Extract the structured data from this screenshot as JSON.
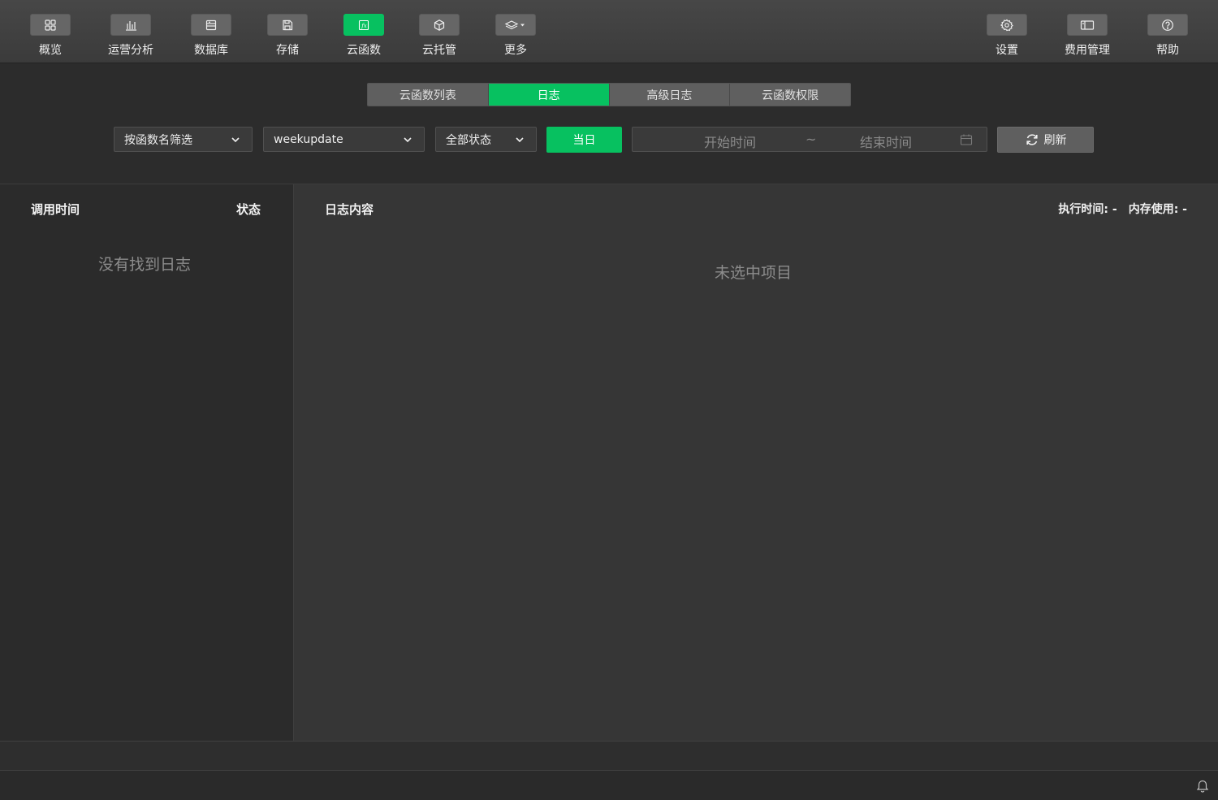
{
  "toolbar": {
    "left_items": [
      {
        "label": "概览",
        "icon": "grid-icon"
      },
      {
        "label": "运营分析",
        "icon": "bar-chart-icon"
      },
      {
        "label": "数据库",
        "icon": "database-icon"
      },
      {
        "label": "存储",
        "icon": "storage-icon"
      },
      {
        "label": "云函数",
        "icon": "function-icon",
        "active": true
      },
      {
        "label": "云托管",
        "icon": "cube-icon"
      },
      {
        "label": "更多",
        "icon": "layers-dropdown-icon"
      }
    ],
    "right_items": [
      {
        "label": "设置",
        "icon": "gear-icon"
      },
      {
        "label": "费用管理",
        "icon": "billing-icon"
      },
      {
        "label": "帮助",
        "icon": "help-icon"
      }
    ]
  },
  "tabs": [
    "云函数列表",
    "日志",
    "高级日志",
    "云函数权限"
  ],
  "active_tab": "日志",
  "filters": {
    "filter_mode": "按函数名筛选",
    "function_name": "weekupdate",
    "status": "全部状态",
    "today_label": "当日",
    "start_placeholder": "开始时间",
    "separator": "~",
    "end_placeholder": "结束时间",
    "refresh_label": "刷新"
  },
  "left_panel": {
    "col_time": "调用时间",
    "col_status": "状态",
    "empty_text": "没有找到日志"
  },
  "right_panel": {
    "title": "日志内容",
    "exec_time": "执行时间: -",
    "memory_usage": "内存使用: -",
    "empty_text": "未选中项目"
  },
  "colors": {
    "accent": "#07c160",
    "toolbar_bg": "#424242",
    "panel_bg": "#363636"
  }
}
